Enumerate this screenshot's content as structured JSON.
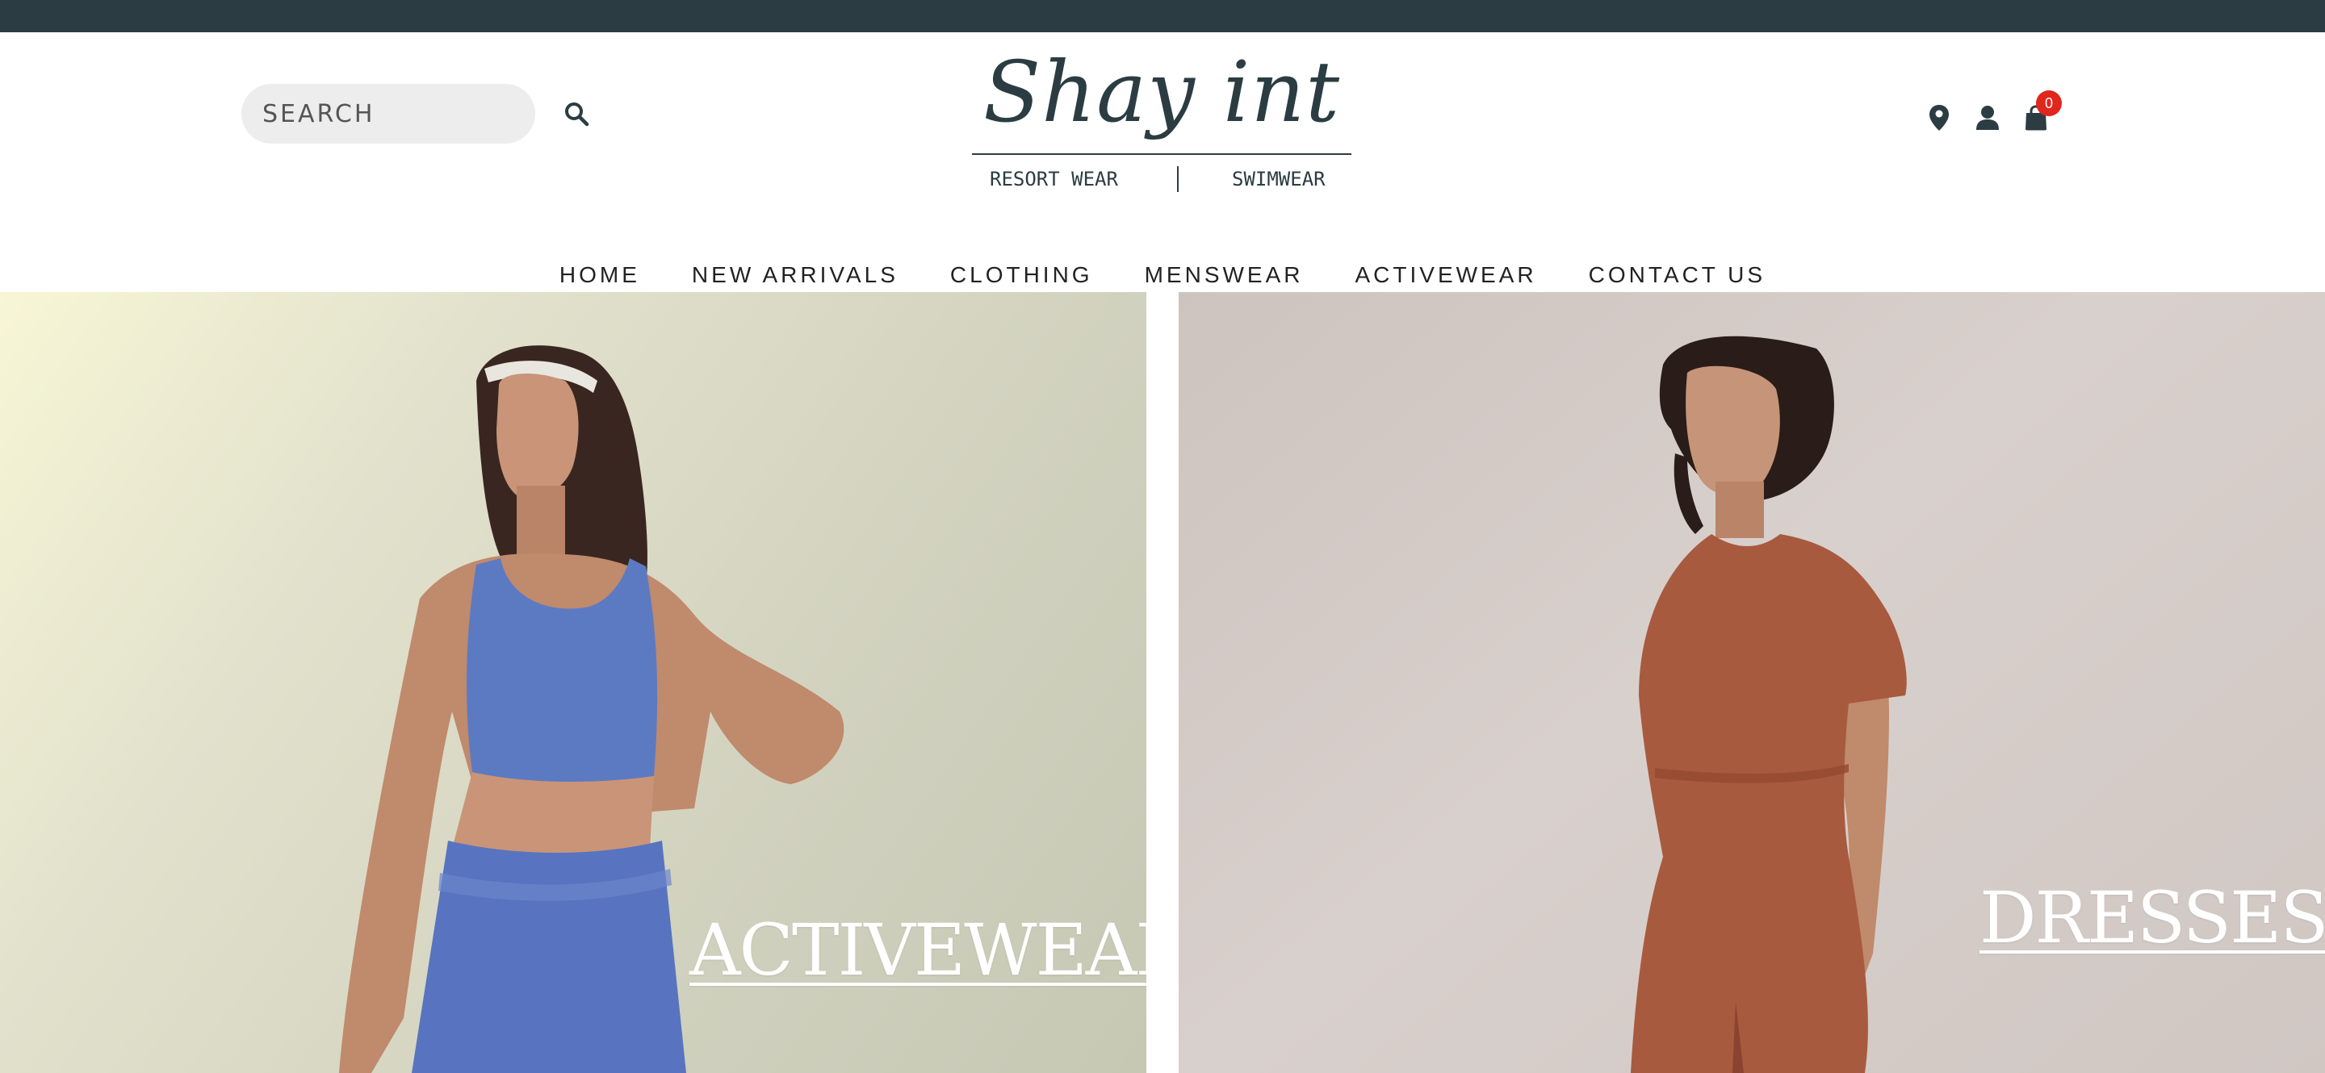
{
  "brand": {
    "logo_text": "Shay int",
    "subline_left": "RESORT WEAR",
    "subline_right": "SWIMWEAR"
  },
  "search": {
    "placeholder": "SEARCH",
    "icon": "search-icon"
  },
  "header_icons": {
    "location_icon": "location-pin-icon",
    "account_icon": "user-icon",
    "cart_icon": "shopping-bag-icon",
    "cart_count": "0"
  },
  "nav": {
    "items": [
      {
        "label": "HOME"
      },
      {
        "label": "NEW ARRIVALS"
      },
      {
        "label": "CLOTHING"
      },
      {
        "label": "MENSWEAR"
      },
      {
        "label": "ACTIVEWEAR"
      },
      {
        "label": "CONTACT US"
      }
    ]
  },
  "hero": {
    "left_label": "ACTIVEWEAR",
    "right_label": "DRESSES"
  },
  "colors": {
    "topbar": "#2b3d42",
    "brand_dark": "#2b3d42",
    "badge": "#e0261d",
    "activewear_blue": "#5c7ac2",
    "dress_rust": "#a85a3e"
  }
}
